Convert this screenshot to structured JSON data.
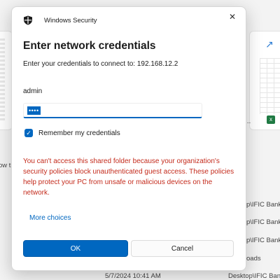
{
  "background": {
    "left_text": "ow t",
    "right_paths": [
      "p\\IFIC Bank",
      "p\\IFIC Bank",
      "p\\IFIC Bank",
      "oads",
      "Desktop\\IFIC Bank"
    ],
    "bottom_date": "5/7/2024 10:41 AM",
    "dots": "..."
  },
  "dialog": {
    "app_title": "Windows Security",
    "close_glyph": "✕",
    "heading": "Enter network credentials",
    "subtitle": "Enter your credentials to connect to: 192.168.12.2",
    "username": "admin",
    "password_mask": "••••",
    "remember": {
      "label": "Remember my credentials",
      "checked": true,
      "check_glyph": "✓"
    },
    "warning": "You can't access this shared folder because your organization's security policies block unauthenticated guest access. These policies help protect your PC from unsafe or malicious devices on the network.",
    "more_choices": "More choices",
    "ok_label": "OK",
    "cancel_label": "Cancel"
  },
  "colors": {
    "accent": "#0067c0",
    "warning": "#c42b1c"
  },
  "icons": {
    "shield": "shield-icon",
    "close": "close-icon",
    "check": "check-icon",
    "trend": "trend-up-icon",
    "excel": "excel-icon"
  }
}
